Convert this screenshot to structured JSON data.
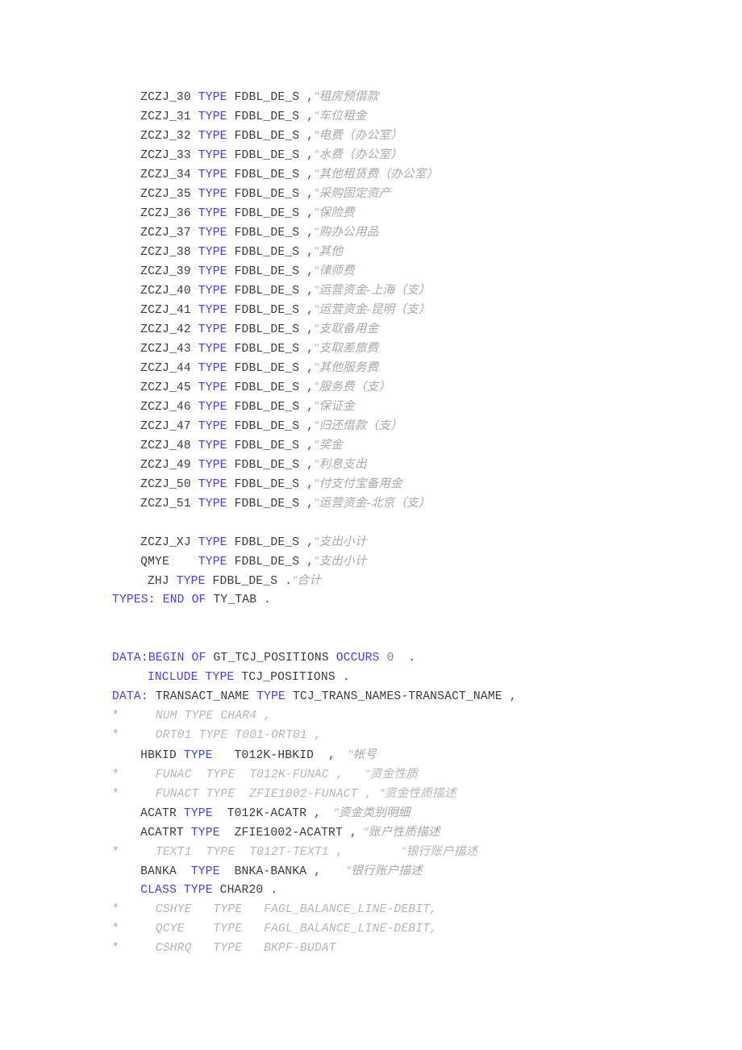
{
  "document": {
    "language": "ABAP",
    "title": "ABAP Source Listing",
    "background_color": "#ffffff",
    "colors": {
      "plain_text": "#3b3b3b",
      "keyword": "#4242e8",
      "punctuation": "#a2119c",
      "number": "#5f8dd8",
      "comment": "#a8a8a8",
      "commented_out": "#b6b6b6"
    }
  },
  "lines": [
    {
      "id": 1,
      "indent": 4,
      "tokens": [
        {
          "t": "ZCZJ_30 ",
          "c": "plain"
        },
        {
          "t": "TYPE",
          "c": "keyword"
        },
        {
          "t": " FDBL_DE_S ",
          "c": "plain"
        },
        {
          "t": ",",
          "c": "punct"
        },
        {
          "t": "\"租房预借款",
          "c": "comment"
        }
      ]
    },
    {
      "id": 2,
      "indent": 4,
      "tokens": [
        {
          "t": "ZCZJ_31 ",
          "c": "plain"
        },
        {
          "t": "TYPE",
          "c": "keyword"
        },
        {
          "t": " FDBL_DE_S ",
          "c": "plain"
        },
        {
          "t": ",",
          "c": "punct"
        },
        {
          "t": "\"车位租金",
          "c": "comment"
        }
      ]
    },
    {
      "id": 3,
      "indent": 4,
      "tokens": [
        {
          "t": "ZCZJ_32 ",
          "c": "plain"
        },
        {
          "t": "TYPE",
          "c": "keyword"
        },
        {
          "t": " FDBL_DE_S ",
          "c": "plain"
        },
        {
          "t": ",",
          "c": "punct"
        },
        {
          "t": "\"电费（办公室）",
          "c": "comment"
        }
      ]
    },
    {
      "id": 4,
      "indent": 4,
      "tokens": [
        {
          "t": "ZCZJ_33 ",
          "c": "plain"
        },
        {
          "t": "TYPE",
          "c": "keyword"
        },
        {
          "t": " FDBL_DE_S ",
          "c": "plain"
        },
        {
          "t": ",",
          "c": "punct"
        },
        {
          "t": "\"水费（办公室）",
          "c": "comment"
        }
      ]
    },
    {
      "id": 5,
      "indent": 4,
      "tokens": [
        {
          "t": "ZCZJ_34 ",
          "c": "plain"
        },
        {
          "t": "TYPE",
          "c": "keyword"
        },
        {
          "t": " FDBL_DE_S ",
          "c": "plain"
        },
        {
          "t": ",",
          "c": "punct"
        },
        {
          "t": "\"其他租赁费（办公室）",
          "c": "comment"
        }
      ]
    },
    {
      "id": 6,
      "indent": 4,
      "tokens": [
        {
          "t": "ZCZJ_35 ",
          "c": "plain"
        },
        {
          "t": "TYPE",
          "c": "keyword"
        },
        {
          "t": " FDBL_DE_S ",
          "c": "plain"
        },
        {
          "t": ",",
          "c": "punct"
        },
        {
          "t": "\"采购固定资产",
          "c": "comment"
        }
      ]
    },
    {
      "id": 7,
      "indent": 4,
      "tokens": [
        {
          "t": "ZCZJ_36 ",
          "c": "plain"
        },
        {
          "t": "TYPE",
          "c": "keyword"
        },
        {
          "t": " FDBL_DE_S ",
          "c": "plain"
        },
        {
          "t": ",",
          "c": "punct"
        },
        {
          "t": "\"保险费",
          "c": "comment"
        }
      ]
    },
    {
      "id": 8,
      "indent": 4,
      "tokens": [
        {
          "t": "ZCZJ_37 ",
          "c": "plain"
        },
        {
          "t": "TYPE",
          "c": "keyword"
        },
        {
          "t": " FDBL_DE_S ",
          "c": "plain"
        },
        {
          "t": ",",
          "c": "punct"
        },
        {
          "t": "\"购办公用品",
          "c": "comment"
        }
      ]
    },
    {
      "id": 9,
      "indent": 4,
      "tokens": [
        {
          "t": "ZCZJ_38 ",
          "c": "plain"
        },
        {
          "t": "TYPE",
          "c": "keyword"
        },
        {
          "t": " FDBL_DE_S ",
          "c": "plain"
        },
        {
          "t": ",",
          "c": "punct"
        },
        {
          "t": "\"其他",
          "c": "comment"
        }
      ]
    },
    {
      "id": 10,
      "indent": 4,
      "tokens": [
        {
          "t": "ZCZJ_39 ",
          "c": "plain"
        },
        {
          "t": "TYPE",
          "c": "keyword"
        },
        {
          "t": " FDBL_DE_S ",
          "c": "plain"
        },
        {
          "t": ",",
          "c": "punct"
        },
        {
          "t": "\"律师费",
          "c": "comment"
        }
      ]
    },
    {
      "id": 11,
      "indent": 4,
      "tokens": [
        {
          "t": "ZCZJ_40 ",
          "c": "plain"
        },
        {
          "t": "TYPE",
          "c": "keyword"
        },
        {
          "t": " FDBL_DE_S ",
          "c": "plain"
        },
        {
          "t": ",",
          "c": "punct"
        },
        {
          "t": "\"运营资金-上海（支）",
          "c": "comment"
        }
      ]
    },
    {
      "id": 12,
      "indent": 4,
      "tokens": [
        {
          "t": "ZCZJ_41 ",
          "c": "plain"
        },
        {
          "t": "TYPE",
          "c": "keyword"
        },
        {
          "t": " FDBL_DE_S ",
          "c": "plain"
        },
        {
          "t": ",",
          "c": "punct"
        },
        {
          "t": "\"运营资金-昆明（支）",
          "c": "comment"
        }
      ]
    },
    {
      "id": 13,
      "indent": 4,
      "tokens": [
        {
          "t": "ZCZJ_42 ",
          "c": "plain"
        },
        {
          "t": "TYPE",
          "c": "keyword"
        },
        {
          "t": " FDBL_DE_S ",
          "c": "plain"
        },
        {
          "t": ",",
          "c": "punct"
        },
        {
          "t": "\"支取备用金",
          "c": "comment"
        }
      ]
    },
    {
      "id": 14,
      "indent": 4,
      "tokens": [
        {
          "t": "ZCZJ_43 ",
          "c": "plain"
        },
        {
          "t": "TYPE",
          "c": "keyword"
        },
        {
          "t": " FDBL_DE_S ",
          "c": "plain"
        },
        {
          "t": ",",
          "c": "punct"
        },
        {
          "t": "\"支取差旅费",
          "c": "comment"
        }
      ]
    },
    {
      "id": 15,
      "indent": 4,
      "tokens": [
        {
          "t": "ZCZJ_44 ",
          "c": "plain"
        },
        {
          "t": "TYPE",
          "c": "keyword"
        },
        {
          "t": " FDBL_DE_S ",
          "c": "plain"
        },
        {
          "t": ",",
          "c": "punct"
        },
        {
          "t": "\"其他服务费",
          "c": "comment"
        }
      ]
    },
    {
      "id": 16,
      "indent": 4,
      "tokens": [
        {
          "t": "ZCZJ_45 ",
          "c": "plain"
        },
        {
          "t": "TYPE",
          "c": "keyword"
        },
        {
          "t": " FDBL_DE_S ",
          "c": "plain"
        },
        {
          "t": ",",
          "c": "punct"
        },
        {
          "t": "\"服务费（支）",
          "c": "comment"
        }
      ]
    },
    {
      "id": 17,
      "indent": 4,
      "tokens": [
        {
          "t": "ZCZJ_46 ",
          "c": "plain"
        },
        {
          "t": "TYPE",
          "c": "keyword"
        },
        {
          "t": " FDBL_DE_S ",
          "c": "plain"
        },
        {
          "t": ",",
          "c": "punct"
        },
        {
          "t": "\"保证金",
          "c": "comment"
        }
      ]
    },
    {
      "id": 18,
      "indent": 4,
      "tokens": [
        {
          "t": "ZCZJ_47 ",
          "c": "plain"
        },
        {
          "t": "TYPE",
          "c": "keyword"
        },
        {
          "t": " FDBL_DE_S ",
          "c": "plain"
        },
        {
          "t": ",",
          "c": "punct"
        },
        {
          "t": "\"归还借款（支）",
          "c": "comment"
        }
      ]
    },
    {
      "id": 19,
      "indent": 4,
      "tokens": [
        {
          "t": "ZCZJ_48 ",
          "c": "plain"
        },
        {
          "t": "TYPE",
          "c": "keyword"
        },
        {
          "t": " FDBL_DE_S ",
          "c": "plain"
        },
        {
          "t": ",",
          "c": "punct"
        },
        {
          "t": "\"奖金",
          "c": "comment"
        }
      ]
    },
    {
      "id": 20,
      "indent": 4,
      "tokens": [
        {
          "t": "ZCZJ_49 ",
          "c": "plain"
        },
        {
          "t": "TYPE",
          "c": "keyword"
        },
        {
          "t": " FDBL_DE_S ",
          "c": "plain"
        },
        {
          "t": ",",
          "c": "punct"
        },
        {
          "t": "\"利息支出",
          "c": "comment"
        }
      ]
    },
    {
      "id": 21,
      "indent": 4,
      "tokens": [
        {
          "t": "ZCZJ_50 ",
          "c": "plain"
        },
        {
          "t": "TYPE",
          "c": "keyword"
        },
        {
          "t": " FDBL_DE_S ",
          "c": "plain"
        },
        {
          "t": ",",
          "c": "punct"
        },
        {
          "t": "\"付支付宝备用金",
          "c": "comment"
        }
      ]
    },
    {
      "id": 22,
      "indent": 4,
      "tokens": [
        {
          "t": "ZCZJ_51 ",
          "c": "plain"
        },
        {
          "t": "TYPE",
          "c": "keyword"
        },
        {
          "t": " FDBL_DE_S ",
          "c": "plain"
        },
        {
          "t": ",",
          "c": "punct"
        },
        {
          "t": "\"运营资金-北京（支）",
          "c": "comment"
        }
      ]
    },
    {
      "id": 23,
      "indent": 0,
      "blank": true,
      "tokens": []
    },
    {
      "id": 24,
      "indent": 4,
      "tokens": [
        {
          "t": "ZCZJ_XJ ",
          "c": "plain"
        },
        {
          "t": "TYPE",
          "c": "keyword"
        },
        {
          "t": " FDBL_DE_S ",
          "c": "plain"
        },
        {
          "t": ",",
          "c": "punct"
        },
        {
          "t": "\"支出小计",
          "c": "comment"
        }
      ]
    },
    {
      "id": 25,
      "indent": 4,
      "tokens": [
        {
          "t": "QMYE    ",
          "c": "plain"
        },
        {
          "t": "TYPE",
          "c": "keyword"
        },
        {
          "t": " FDBL_DE_S ",
          "c": "plain"
        },
        {
          "t": ",",
          "c": "punct"
        },
        {
          "t": "\"支出小计",
          "c": "comment"
        }
      ]
    },
    {
      "id": 26,
      "indent": 5,
      "tokens": [
        {
          "t": "ZHJ ",
          "c": "plain"
        },
        {
          "t": "TYPE",
          "c": "keyword"
        },
        {
          "t": " FDBL_DE_S ",
          "c": "plain"
        },
        {
          "t": ".",
          "c": "punct"
        },
        {
          "t": "\"合计",
          "c": "comment"
        }
      ]
    },
    {
      "id": 27,
      "indent": 0,
      "tokens": [
        {
          "t": "TYPES",
          "c": "keyword"
        },
        {
          "t": ":",
          "c": "punct"
        },
        {
          "t": " ",
          "c": "plain"
        },
        {
          "t": "END OF",
          "c": "keyword"
        },
        {
          "t": " TY_TAB ",
          "c": "plain"
        },
        {
          "t": ".",
          "c": "punct"
        }
      ]
    },
    {
      "id": 28,
      "indent": 0,
      "blank": true,
      "tokens": []
    },
    {
      "id": 29,
      "indent": 0,
      "blank": true,
      "tokens": []
    },
    {
      "id": 30,
      "indent": 0,
      "tokens": [
        {
          "t": "DATA",
          "c": "keyword"
        },
        {
          "t": ":",
          "c": "punct"
        },
        {
          "t": "BEGIN OF",
          "c": "keyword"
        },
        {
          "t": " GT_TCJ_POSITIONS ",
          "c": "plain"
        },
        {
          "t": "OCCURS",
          "c": "keyword"
        },
        {
          "t": " ",
          "c": "plain"
        },
        {
          "t": "0",
          "c": "number"
        },
        {
          "t": "  ",
          "c": "plain"
        },
        {
          "t": ".",
          "c": "punct"
        }
      ]
    },
    {
      "id": 31,
      "indent": 5,
      "tokens": [
        {
          "t": "INCLUDE TYPE",
          "c": "keyword"
        },
        {
          "t": " TCJ_POSITIONS ",
          "c": "plain"
        },
        {
          "t": ".",
          "c": "punct"
        }
      ]
    },
    {
      "id": 32,
      "indent": 0,
      "tokens": [
        {
          "t": "DATA",
          "c": "keyword"
        },
        {
          "t": ":",
          "c": "punct"
        },
        {
          "t": " TRANSACT_NAME ",
          "c": "plain"
        },
        {
          "t": "TYPE",
          "c": "keyword"
        },
        {
          "t": " TCJ_TRANS_NAMES-TRANSACT_NAME ",
          "c": "plain"
        },
        {
          "t": ",",
          "c": "punct"
        }
      ]
    },
    {
      "id": 33,
      "indent": 0,
      "tokens": [
        {
          "t": "*",
          "c": "star"
        },
        {
          "t": "     NUM TYPE CHAR4 ,",
          "c": "commented"
        }
      ]
    },
    {
      "id": 34,
      "indent": 0,
      "tokens": [
        {
          "t": "*",
          "c": "star"
        },
        {
          "t": "     ORT01 TYPE T001-ORT01 ,",
          "c": "commented"
        }
      ]
    },
    {
      "id": 35,
      "indent": 4,
      "tokens": [
        {
          "t": "HBKID ",
          "c": "plain"
        },
        {
          "t": "TYPE",
          "c": "keyword"
        },
        {
          "t": "   T012K-HBKID  ",
          "c": "plain"
        },
        {
          "t": ",",
          "c": "punct"
        },
        {
          "t": "    \"帐号",
          "c": "comment"
        }
      ]
    },
    {
      "id": 36,
      "indent": 0,
      "tokens": [
        {
          "t": "*",
          "c": "star"
        },
        {
          "t": "     FUNAC  TYPE  T012K-FUNAC ,   ",
          "c": "commented"
        },
        {
          "t": "\"资金性质",
          "c": "commented"
        }
      ]
    },
    {
      "id": 37,
      "indent": 0,
      "tokens": [
        {
          "t": "*",
          "c": "star"
        },
        {
          "t": "     FUNACT TYPE  ZFIE1002-FUNACT , ",
          "c": "commented"
        },
        {
          "t": "\"资金性质描述",
          "c": "commented"
        }
      ]
    },
    {
      "id": 38,
      "indent": 4,
      "tokens": [
        {
          "t": "ACATR ",
          "c": "plain"
        },
        {
          "t": "TYPE",
          "c": "keyword"
        },
        {
          "t": "  T012K-ACATR ",
          "c": "plain"
        },
        {
          "t": ",",
          "c": "punct"
        },
        {
          "t": "    \"资金类别明细",
          "c": "comment"
        }
      ]
    },
    {
      "id": 39,
      "indent": 4,
      "tokens": [
        {
          "t": "ACATRT ",
          "c": "plain"
        },
        {
          "t": "TYPE",
          "c": "keyword"
        },
        {
          "t": "  ZFIE1002-ACATRT ",
          "c": "plain"
        },
        {
          "t": ",",
          "c": "punct"
        },
        {
          "t": "  \"账户性质描述",
          "c": "comment"
        }
      ]
    },
    {
      "id": 40,
      "indent": 0,
      "tokens": [
        {
          "t": "*",
          "c": "star"
        },
        {
          "t": "     TEXT1  TYPE  T012T-TEXT1 ,        ",
          "c": "commented"
        },
        {
          "t": "\"银行账户描述",
          "c": "commented"
        }
      ]
    },
    {
      "id": 41,
      "indent": 4,
      "tokens": [
        {
          "t": "BANKA  ",
          "c": "plain"
        },
        {
          "t": "TYPE",
          "c": "keyword"
        },
        {
          "t": "  BNKA-BANKA ",
          "c": "plain"
        },
        {
          "t": ",",
          "c": "punct"
        },
        {
          "t": "        \"银行账户描述",
          "c": "comment"
        }
      ]
    },
    {
      "id": 42,
      "indent": 4,
      "tokens": [
        {
          "t": "CLASS TYPE",
          "c": "keyword"
        },
        {
          "t": " CHAR20 ",
          "c": "plain"
        },
        {
          "t": ".",
          "c": "punct"
        }
      ]
    },
    {
      "id": 43,
      "indent": 0,
      "tokens": [
        {
          "t": "*",
          "c": "star"
        },
        {
          "t": "     CSHYE   TYPE   FAGL_BALANCE_LINE-DEBIT,",
          "c": "commented"
        }
      ]
    },
    {
      "id": 44,
      "indent": 0,
      "tokens": [
        {
          "t": "*",
          "c": "star"
        },
        {
          "t": "     QCYE    TYPE   FAGL_BALANCE_LINE-DEBIT,",
          "c": "commented"
        }
      ]
    },
    {
      "id": 45,
      "indent": 0,
      "tokens": [
        {
          "t": "*",
          "c": "star"
        },
        {
          "t": "     CSHRQ   TYPE   BKPF-BUDAT",
          "c": "commented"
        }
      ]
    }
  ]
}
